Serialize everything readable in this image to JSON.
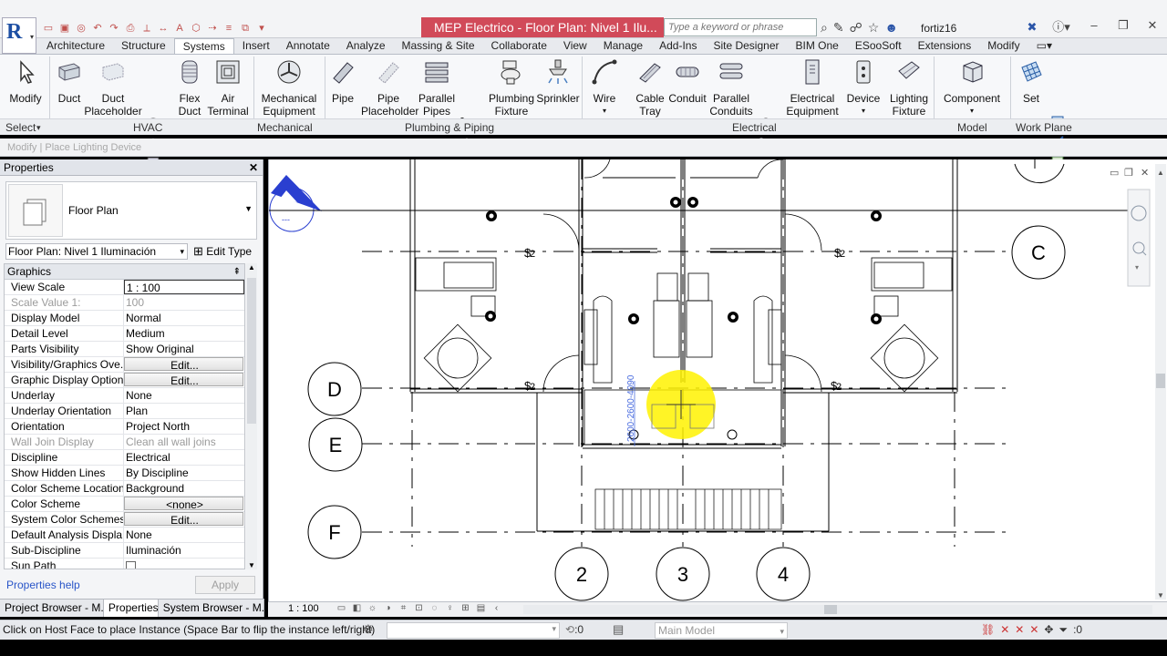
{
  "window": {
    "title": "MEP Electrico - Floor Plan: Nivel 1 Ilu...",
    "search_placeholder": "Type a keyword or phrase",
    "username": "fortiz16"
  },
  "ribbon_tabs": [
    "Architecture",
    "Structure",
    "Systems",
    "Insert",
    "Annotate",
    "Analyze",
    "Massing & Site",
    "Collaborate",
    "View",
    "Manage",
    "Add-Ins",
    "Site Designer",
    "BIM One",
    "ESooSoft",
    "Extensions",
    "Modify"
  ],
  "active_tab": "Systems",
  "tools": {
    "modify": "Modify",
    "duct": "Duct",
    "duct_placeholder": "Duct Placeholder",
    "flex_duct": "Flex Duct",
    "air_terminal": "Air Terminal",
    "mechanical_equipment": "Mechanical Equipment",
    "pipe": "Pipe",
    "pipe_placeholder": "Pipe Placeholder",
    "parallel_pipes": "Parallel Pipes",
    "plumbing_fixture": "Plumbing Fixture",
    "sprinkler": "Sprinkler",
    "wire": "Wire",
    "cable_tray": "Cable Tray",
    "conduit": "Conduit",
    "parallel_conduits": "Parallel Conduits",
    "electrical_equipment": "Electrical Equipment",
    "device": "Device",
    "lighting_fixture": "Lighting Fixture",
    "component": "Component",
    "set": "Set"
  },
  "panels": {
    "select": "Select",
    "hvac": "HVAC",
    "mechanical": "Mechanical",
    "plumbing": "Plumbing & Piping",
    "electrical": "Electrical",
    "model": "Model",
    "work_plane": "Work Plane"
  },
  "context_bar": "Modify | Place Lighting Device",
  "properties": {
    "title": "Properties",
    "type_name": "Floor Plan",
    "instance_selector": "Floor Plan: Nivel 1 Iluminación",
    "edit_type": "Edit Type",
    "group": "Graphics",
    "rows": [
      {
        "name": "View Scale",
        "value": "1 : 100",
        "style": "box"
      },
      {
        "name": "Scale Value    1:",
        "value": "100",
        "style": "disabled"
      },
      {
        "name": "Display Model",
        "value": "Normal",
        "style": ""
      },
      {
        "name": "Detail Level",
        "value": "Medium",
        "style": ""
      },
      {
        "name": "Parts Visibility",
        "value": "Show Original",
        "style": ""
      },
      {
        "name": "Visibility/Graphics Ove...",
        "value": "Edit...",
        "style": "btn"
      },
      {
        "name": "Graphic Display Options",
        "value": "Edit...",
        "style": "btn"
      },
      {
        "name": "Underlay",
        "value": "None",
        "style": ""
      },
      {
        "name": "Underlay Orientation",
        "value": "Plan",
        "style": ""
      },
      {
        "name": "Orientation",
        "value": "Project North",
        "style": ""
      },
      {
        "name": "Wall Join Display",
        "value": "Clean all wall joins",
        "style": "disabled"
      },
      {
        "name": "Discipline",
        "value": "Electrical",
        "style": ""
      },
      {
        "name": "Show Hidden Lines",
        "value": "By Discipline",
        "style": ""
      },
      {
        "name": "Color Scheme Location",
        "value": "Background",
        "style": ""
      },
      {
        "name": "Color Scheme",
        "value": "<none>",
        "style": "btn"
      },
      {
        "name": "System Color Schemes",
        "value": "Edit...",
        "style": "btn"
      },
      {
        "name": "Default Analysis Displa...",
        "value": "None",
        "style": ""
      },
      {
        "name": "Sub-Discipline",
        "value": "Iluminación",
        "style": ""
      },
      {
        "name": "Sun Path",
        "value": "",
        "style": "check"
      }
    ],
    "help_link": "Properties help",
    "apply": "Apply"
  },
  "browser_tabs": [
    "Project Browser - M...",
    "Properties",
    "System Browser - M..."
  ],
  "active_browser_tab": "Properties",
  "drawing": {
    "grid_letters": [
      "C",
      "D",
      "E",
      "F"
    ],
    "grid_numbers": [
      "2",
      "3",
      "4"
    ],
    "dimension_text": "2600-2600-4090"
  },
  "view_scale": "1 : 100",
  "status": {
    "message": "Click on Host Face to place Instance (Space Bar to flip the instance left/right)",
    "filter_count": ":0",
    "model": "Main Model",
    "selection_count": ":0"
  },
  "colors": {
    "title_accent": "#d14a59",
    "highlight": "#fff200",
    "link": "#2955c8"
  }
}
